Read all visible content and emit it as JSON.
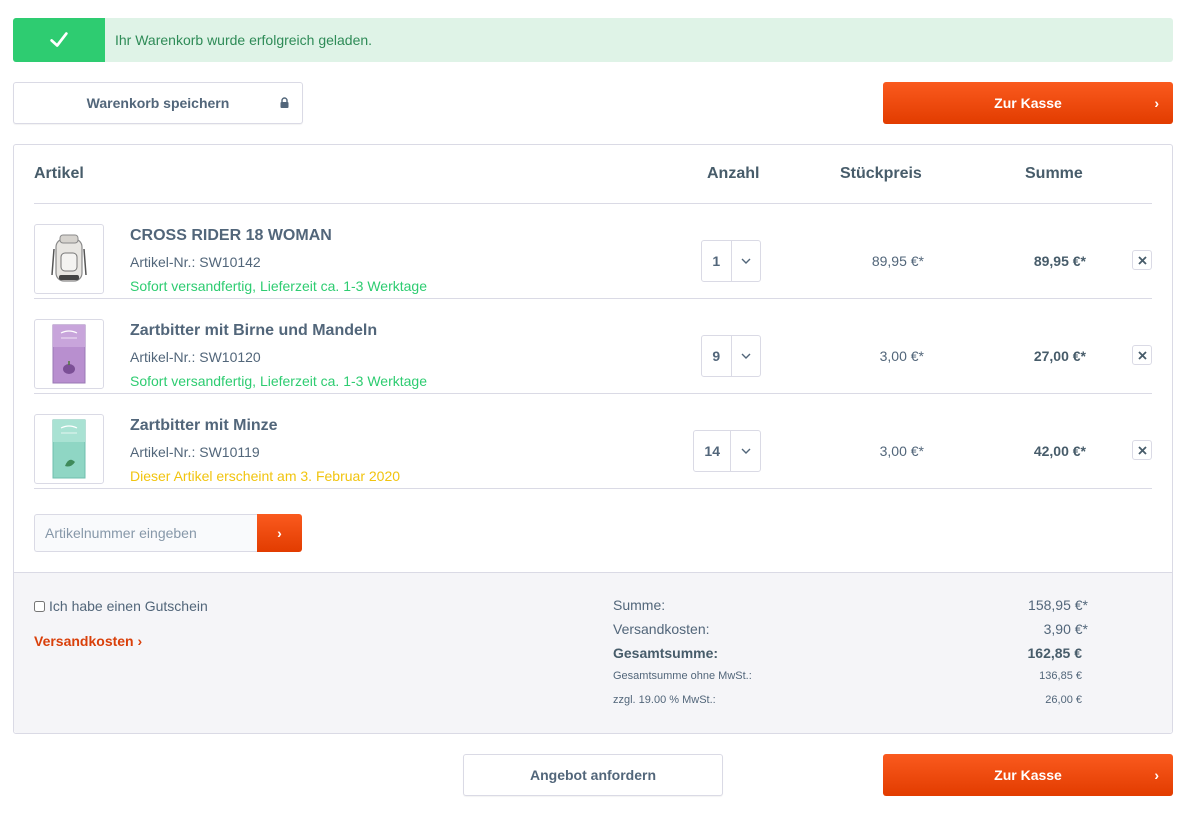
{
  "alert": {
    "message": "Ihr Warenkorb wurde erfolgreich geladen."
  },
  "actions": {
    "save_cart": "Warenkorb speichern",
    "checkout": "Zur Kasse",
    "request_offer": "Angebot anfordern"
  },
  "table": {
    "headers": {
      "article": "Artikel",
      "quantity": "Anzahl",
      "unit_price": "Stückpreis",
      "total": "Summe"
    },
    "items": [
      {
        "name": "CROSS RIDER 18 WOMAN",
        "sku": "Artikel-Nr.: SW10142",
        "status": "Sofort versandfertig, Lieferzeit ca. 1-3 Werktage",
        "status_type": "ok",
        "quantity": "1",
        "unit_price": "89,95 €*",
        "total": "89,95 €*",
        "thumb_icon": "backpack-icon"
      },
      {
        "name": "Zartbitter mit Birne und Mandeln",
        "sku": "Artikel-Nr.: SW10120",
        "status": "Sofort versandfertig, Lieferzeit ca. 1-3 Werktage",
        "status_type": "ok",
        "quantity": "9",
        "unit_price": "3,00 €*",
        "total": "27,00 €*",
        "thumb_icon": "chocolate-purple-icon"
      },
      {
        "name": "Zartbitter mit Minze",
        "sku": "Artikel-Nr.: SW10119",
        "status": "Dieser Artikel erscheint am 3. Februar 2020",
        "status_type": "soon",
        "quantity": "14",
        "unit_price": "3,00 €*",
        "total": "42,00 €*",
        "thumb_icon": "chocolate-mint-icon"
      }
    ]
  },
  "add_product": {
    "placeholder": "Artikelnummer eingeben"
  },
  "footer": {
    "voucher_label": "Ich habe einen Gutschein",
    "shipping_link": "Versandkosten"
  },
  "summary": {
    "sum_label": "Summe:",
    "sum_value": "158,95 €*",
    "shipping_label": "Versandkosten:",
    "shipping_value": "3,90 €*",
    "grand_label": "Gesamtsumme:",
    "grand_value": "162,85 €",
    "net_label": "Gesamtsumme ohne MwSt.:",
    "net_value": "136,85 €",
    "tax_label": "zzgl. 19.00 % MwSt.:",
    "tax_value": "26,00 €"
  },
  "colors": {
    "accent": "#e23c00",
    "success": "#2ecc71",
    "warning": "#f1c40f"
  }
}
